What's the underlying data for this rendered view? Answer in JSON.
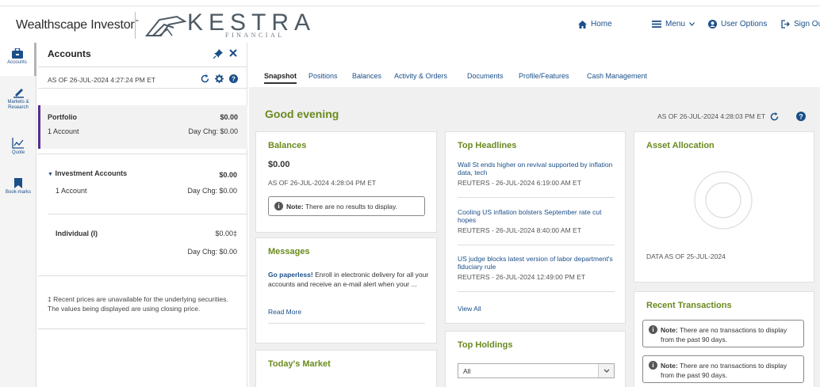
{
  "header": {
    "brand": "Wealthscape Investor",
    "brand_mark": "℠",
    "logo_word": "KESTRA",
    "logo_sub": "FINANCIAL",
    "nav": {
      "home": "Home",
      "menu": "Menu",
      "user_options": "User Options",
      "sign_out": "Sign Ou"
    }
  },
  "rail": [
    {
      "label": "Accounts",
      "icon": "briefcase-icon"
    },
    {
      "label": "Markets & Research",
      "icon": "chart-pen-icon"
    },
    {
      "label": "Quote",
      "icon": "line-chart-icon"
    },
    {
      "label": "Book-marks",
      "icon": "bookmark-icon"
    }
  ],
  "accounts_panel": {
    "title": "Accounts",
    "as_of": "AS OF 26-JUL-2024 4:27:24 PM ET",
    "portfolio": {
      "label": "Portfolio",
      "value": "$0.00",
      "count": "1 Account",
      "day_chg": "Day Chg: $0.00"
    },
    "investment": {
      "label": "Investment Accounts",
      "value": "$0.00",
      "count": "1 Account",
      "day_chg": "Day Chg: $0.00"
    },
    "individual": {
      "label": "Individual (I)",
      "value": "$0.00‡",
      "day_chg": "Day Chg: $0.00"
    },
    "footnote": "‡ Recent prices are unavailable for the underlying securities. The values being displayed are using closing price."
  },
  "tabs": [
    "Snapshot",
    "Positions",
    "Balances",
    "Activity & Orders",
    "Documents",
    "Profile/Features",
    "Cash Management"
  ],
  "main": {
    "greeting": "Good evening",
    "as_of": "AS OF 26-JUL-2024 4:28:03 PM ET",
    "balances": {
      "title": "Balances",
      "amount": "$0.00",
      "as_of": "AS OF 26-JUL-2024 4:28:04 PM ET",
      "note_label": "Note:",
      "note_text": "There are no results to display."
    },
    "messages": {
      "title": "Messages",
      "lead": "Go paperless!",
      "body": "Enroll in electronic delivery for all your accounts and receive an e-mail alert when your ...",
      "read_more": "Read More"
    },
    "todays_market": {
      "title": "Today's Market"
    },
    "headlines": {
      "title": "Top Headlines",
      "items": [
        {
          "title": "Wall St ends higher on revival supported by inflation data, tech",
          "source": "REUTERS - 26-JUL-2024 6:19:00 AM ET"
        },
        {
          "title": "Cooling US inflation bolsters September rate cut hopes",
          "source": "REUTERS - 26-JUL-2024 8:40:00 AM ET"
        },
        {
          "title": "US judge blocks latest version of labor department's fiduciary rule",
          "source": "REUTERS - 26-JUL-2024 12:49:00 PM ET"
        }
      ],
      "view_all": "View All"
    },
    "holdings": {
      "title": "Top Holdings",
      "filter": "All"
    },
    "allocation": {
      "title": "Asset Allocation",
      "data_as_of": "DATA AS OF 25-JUL-2024"
    },
    "transactions": {
      "title": "Recent Transactions",
      "note_label": "Note:",
      "notes": [
        "There are no transactions to display from the past 90 days.",
        "There are no transactions to display from the past 90 days."
      ]
    }
  },
  "colors": {
    "accent_green": "#6a8a1e",
    "link_blue": "#1b4f89",
    "portfolio_bar": "#5a2d91"
  }
}
